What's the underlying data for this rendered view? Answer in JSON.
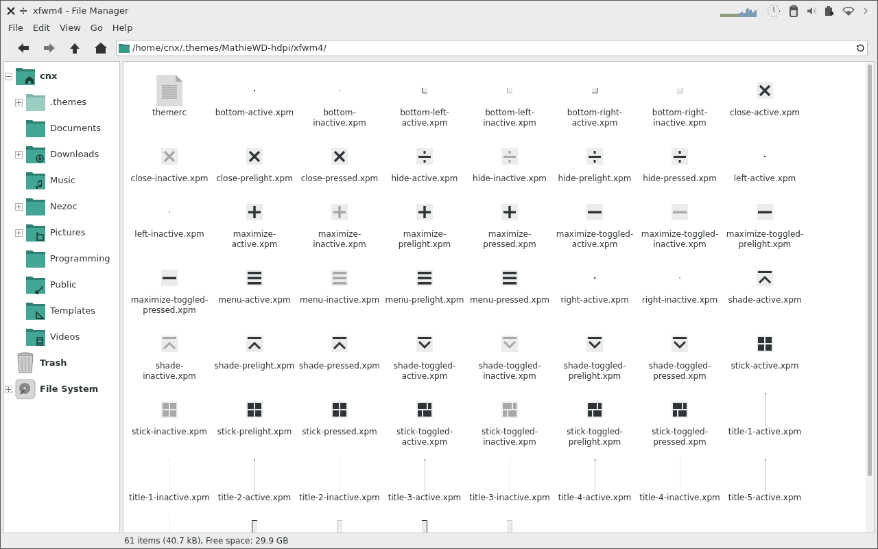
{
  "window": {
    "title": "xfwm4 - File Manager"
  },
  "menu": [
    "File",
    "Edit",
    "View",
    "Go",
    "Help"
  ],
  "location": {
    "value": "/home/cnx/.themes/MathieWD-hdpi/xfwm4/"
  },
  "sidebar": {
    "items": [
      {
        "label": "cnx",
        "kind": "home",
        "expanded": true,
        "children": [
          {
            "label": ".themes",
            "kind": "folder-hidden",
            "expanded": false
          },
          {
            "label": "Documents",
            "kind": "folder"
          },
          {
            "label": "Downloads",
            "kind": "download",
            "expanded": false
          },
          {
            "label": "Music",
            "kind": "music"
          },
          {
            "label": "Nezoc",
            "kind": "folder",
            "expanded": false
          },
          {
            "label": "Pictures",
            "kind": "pictures",
            "expanded": false
          },
          {
            "label": "Programming",
            "kind": "folder"
          },
          {
            "label": "Public",
            "kind": "public"
          },
          {
            "label": "Templates",
            "kind": "templates"
          },
          {
            "label": "Videos",
            "kind": "videos"
          }
        ]
      },
      {
        "label": "Trash",
        "kind": "trash"
      },
      {
        "label": "File System",
        "kind": "drive",
        "expanded": false
      }
    ]
  },
  "files": [
    {
      "name": "themerc",
      "kind": "document"
    },
    {
      "name": "bottom-active.xpm",
      "kind": "dot",
      "faded": false
    },
    {
      "name": "bottom-inactive.xpm",
      "kind": "dot",
      "faded": true
    },
    {
      "name": "bottom-left-active.xpm",
      "kind": "corner-left",
      "faded": false
    },
    {
      "name": "bottom-left-inactive.xpm",
      "kind": "corner-left",
      "faded": true
    },
    {
      "name": "bottom-right-active.xpm",
      "kind": "corner-right",
      "faded": false
    },
    {
      "name": "bottom-right-inactive.xpm",
      "kind": "corner-right",
      "faded": true
    },
    {
      "name": "close-active.xpm",
      "kind": "close",
      "faded": false
    },
    {
      "name": "close-inactive.xpm",
      "kind": "close",
      "faded": true
    },
    {
      "name": "close-prelight.xpm",
      "kind": "close",
      "faded": false
    },
    {
      "name": "close-pressed.xpm",
      "kind": "close",
      "faded": false
    },
    {
      "name": "hide-active.xpm",
      "kind": "hide",
      "faded": false
    },
    {
      "name": "hide-inactive.xpm",
      "kind": "hide",
      "faded": true
    },
    {
      "name": "hide-prelight.xpm",
      "kind": "hide",
      "faded": false
    },
    {
      "name": "hide-pressed.xpm",
      "kind": "hide",
      "faded": false
    },
    {
      "name": "left-active.xpm",
      "kind": "dot",
      "faded": false
    },
    {
      "name": "left-inactive.xpm",
      "kind": "dot",
      "faded": true
    },
    {
      "name": "maximize-active.xpm",
      "kind": "maximize",
      "faded": false
    },
    {
      "name": "maximize-inactive.xpm",
      "kind": "maximize",
      "faded": true
    },
    {
      "name": "maximize-prelight.xpm",
      "kind": "maximize",
      "faded": false
    },
    {
      "name": "maximize-pressed.xpm",
      "kind": "maximize",
      "faded": false
    },
    {
      "name": "maximize-toggled-active.xpm",
      "kind": "restore",
      "faded": false
    },
    {
      "name": "maximize-toggled-inactive.xpm",
      "kind": "restore",
      "faded": true
    },
    {
      "name": "maximize-toggled-prelight.xpm",
      "kind": "restore",
      "faded": false
    },
    {
      "name": "maximize-toggled-pressed.xpm",
      "kind": "restore",
      "faded": false
    },
    {
      "name": "menu-active.xpm",
      "kind": "menu",
      "faded": false
    },
    {
      "name": "menu-inactive.xpm",
      "kind": "menu",
      "faded": true
    },
    {
      "name": "menu-prelight.xpm",
      "kind": "menu",
      "faded": false
    },
    {
      "name": "menu-pressed.xpm",
      "kind": "menu",
      "faded": false
    },
    {
      "name": "right-active.xpm",
      "kind": "dot",
      "faded": false
    },
    {
      "name": "right-inactive.xpm",
      "kind": "dot",
      "faded": true
    },
    {
      "name": "shade-active.xpm",
      "kind": "shade",
      "faded": false
    },
    {
      "name": "shade-inactive.xpm",
      "kind": "shade",
      "faded": true
    },
    {
      "name": "shade-prelight.xpm",
      "kind": "shade",
      "faded": false
    },
    {
      "name": "shade-pressed.xpm",
      "kind": "shade",
      "faded": false
    },
    {
      "name": "shade-toggled-active.xpm",
      "kind": "unshade",
      "faded": false
    },
    {
      "name": "shade-toggled-inactive.xpm",
      "kind": "unshade",
      "faded": true
    },
    {
      "name": "shade-toggled-prelight.xpm",
      "kind": "unshade",
      "faded": false
    },
    {
      "name": "shade-toggled-pressed.xpm",
      "kind": "unshade",
      "faded": false
    },
    {
      "name": "stick-active.xpm",
      "kind": "stick",
      "faded": false
    },
    {
      "name": "stick-inactive.xpm",
      "kind": "stick",
      "faded": true
    },
    {
      "name": "stick-prelight.xpm",
      "kind": "stick",
      "faded": false
    },
    {
      "name": "stick-pressed.xpm",
      "kind": "stick",
      "faded": false
    },
    {
      "name": "stick-toggled-active.xpm",
      "kind": "unstick",
      "faded": false
    },
    {
      "name": "stick-toggled-inactive.xpm",
      "kind": "unstick",
      "faded": true
    },
    {
      "name": "stick-toggled-prelight.xpm",
      "kind": "unstick",
      "faded": false
    },
    {
      "name": "stick-toggled-pressed.xpm",
      "kind": "unstick",
      "faded": false
    },
    {
      "name": "title-1-active.xpm",
      "kind": "line",
      "faded": false
    },
    {
      "name": "title-1-inactive.xpm",
      "kind": "line",
      "faded": true
    },
    {
      "name": "title-2-active.xpm",
      "kind": "line",
      "faded": false
    },
    {
      "name": "title-2-inactive.xpm",
      "kind": "line",
      "faded": true
    },
    {
      "name": "title-3-active.xpm",
      "kind": "line",
      "faded": false
    },
    {
      "name": "title-3-inactive.xpm",
      "kind": "line",
      "faded": true
    },
    {
      "name": "title-4-active.xpm",
      "kind": "line",
      "faded": false
    },
    {
      "name": "title-4-inactive.xpm",
      "kind": "line",
      "faded": true
    },
    {
      "name": "title-5-active.xpm",
      "kind": "line",
      "faded": false
    },
    {
      "kind": "line",
      "faded": true
    },
    {
      "kind": "edge-left",
      "faded": false
    },
    {
      "kind": "edge-left",
      "faded": true
    },
    {
      "kind": "edge-right",
      "faded": false
    },
    {
      "kind": "edge-right",
      "faded": true
    }
  ],
  "status_bar": "61 items (40.7 kB), Free space: 29.9 GB"
}
